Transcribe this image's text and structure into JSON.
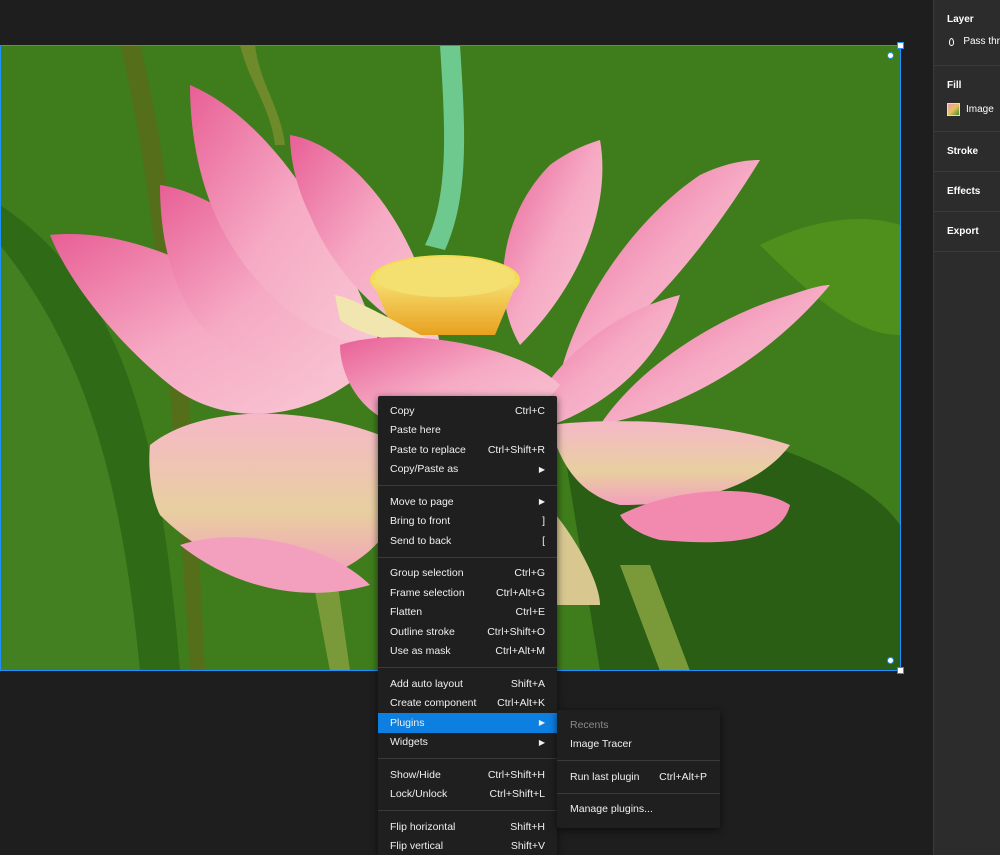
{
  "panel": {
    "layer_title": "Layer",
    "layer_mode": "Pass thr",
    "fill_title": "Fill",
    "fill_type": "Image",
    "stroke_title": "Stroke",
    "effects_title": "Effects",
    "export_title": "Export"
  },
  "context_menu": {
    "groups": [
      [
        {
          "label": "Copy",
          "shortcut": "Ctrl+C"
        },
        {
          "label": "Paste here",
          "shortcut": ""
        },
        {
          "label": "Paste to replace",
          "shortcut": "Ctrl+Shift+R"
        },
        {
          "label": "Copy/Paste as",
          "shortcut": "▶"
        }
      ],
      [
        {
          "label": "Move to page",
          "shortcut": "▶"
        },
        {
          "label": "Bring to front",
          "shortcut": "]"
        },
        {
          "label": "Send to back",
          "shortcut": "["
        }
      ],
      [
        {
          "label": "Group selection",
          "shortcut": "Ctrl+G"
        },
        {
          "label": "Frame selection",
          "shortcut": "Ctrl+Alt+G"
        },
        {
          "label": "Flatten",
          "shortcut": "Ctrl+E"
        },
        {
          "label": "Outline stroke",
          "shortcut": "Ctrl+Shift+O"
        },
        {
          "label": "Use as mask",
          "shortcut": "Ctrl+Alt+M"
        }
      ],
      [
        {
          "label": "Add auto layout",
          "shortcut": "Shift+A"
        },
        {
          "label": "Create component",
          "shortcut": "Ctrl+Alt+K"
        },
        {
          "label": "Plugins",
          "shortcut": "▶"
        },
        {
          "label": "Widgets",
          "shortcut": "▶"
        }
      ],
      [
        {
          "label": "Show/Hide",
          "shortcut": "Ctrl+Shift+H"
        },
        {
          "label": "Lock/Unlock",
          "shortcut": "Ctrl+Shift+L"
        }
      ],
      [
        {
          "label": "Flip horizontal",
          "shortcut": "Shift+H"
        },
        {
          "label": "Flip vertical",
          "shortcut": "Shift+V"
        }
      ]
    ]
  },
  "plugins_submenu": {
    "recents_header": "Recents",
    "recent_plugin": "Image Tracer",
    "run_last_label": "Run last plugin",
    "run_last_shortcut": "Ctrl+Alt+P",
    "manage_label": "Manage plugins..."
  },
  "colors": {
    "accent": "#0d7fe0",
    "selection": "#1e90ff",
    "frame_bg": "#3c7a1a",
    "petal": "#f0a0bc"
  }
}
